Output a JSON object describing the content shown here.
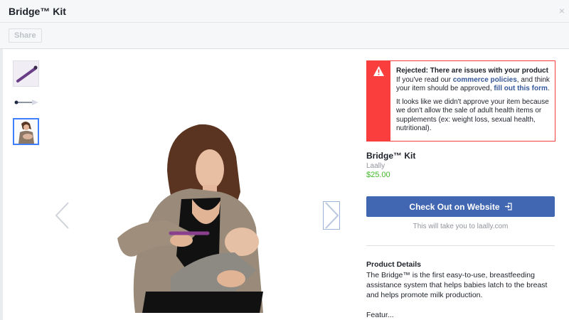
{
  "dialog": {
    "title": "Bridge™ Kit",
    "close_icon": "×",
    "share_label": "Share"
  },
  "alert": {
    "heading": "Rejected: There are issues with your product",
    "line1_pre": "If you've read our ",
    "line1_link": "commerce policies",
    "line1_mid": ", and think your item should be approved, ",
    "line1_link2": "fill out this form",
    "line1_end": ".",
    "line2": "It looks like we didn't approve your item because we don't allow the sale of adult health items or supplements (ex: weight loss, sexual health, nutritional).",
    "accent": "#fa3e3e"
  },
  "product": {
    "title": "Bridge™ Kit",
    "seller": "Laally",
    "price": "$25.00",
    "checkout_label": "Check Out on Website",
    "hint": "This will take you to laally.com",
    "details_title": "Product Details",
    "details_text": "The Bridge™ is the first easy-to-use, breastfeeding assistance system that helps babies latch to the breast and helps promote milk production.",
    "features_text": "Featur..."
  },
  "colors": {
    "primary": "#4267b2",
    "price": "#42b72a",
    "link": "#365899"
  }
}
